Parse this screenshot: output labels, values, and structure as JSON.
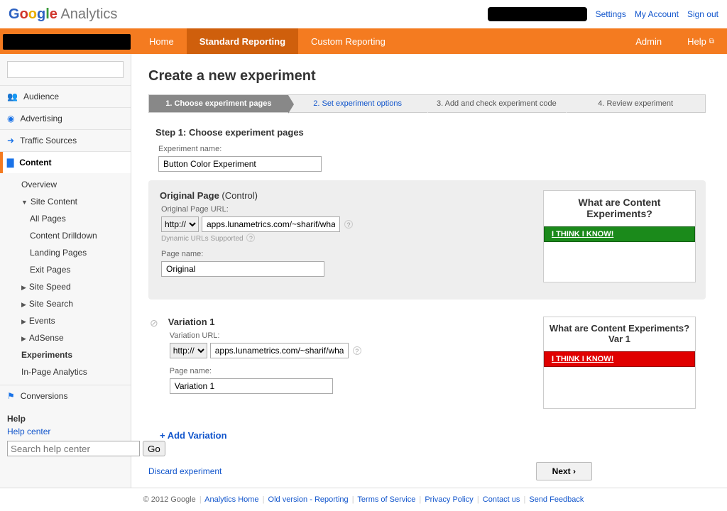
{
  "top": {
    "logo_analytics": "Analytics",
    "links": {
      "settings": "Settings",
      "account": "My Account",
      "signout": "Sign out"
    }
  },
  "nav": {
    "home": "Home",
    "standard": "Standard Reporting",
    "custom": "Custom Reporting",
    "admin": "Admin",
    "help": "Help"
  },
  "sidebar": {
    "audience": "Audience",
    "advertising": "Advertising",
    "traffic": "Traffic Sources",
    "content": "Content",
    "content_items": {
      "overview": "Overview",
      "site_content": "Site Content",
      "all_pages": "All Pages",
      "drilldown": "Content Drilldown",
      "landing": "Landing Pages",
      "exit": "Exit Pages",
      "site_speed": "Site Speed",
      "site_search": "Site Search",
      "events": "Events",
      "adsense": "AdSense",
      "experiments": "Experiments",
      "inpage": "In-Page Analytics"
    },
    "conversions": "Conversions",
    "help_title": "Help",
    "help_center": "Help center",
    "help_placeholder": "Search help center",
    "go": "Go"
  },
  "main": {
    "title": "Create a new experiment",
    "steps": {
      "s1": "1. Choose experiment pages",
      "s2": "2. Set experiment options",
      "s3": "3. Add and check experiment code",
      "s4": "4. Review experiment"
    },
    "step_head": "Step 1: Choose experiment pages",
    "exp_name_label": "Experiment name:",
    "exp_name_value": "Button Color Experiment",
    "original": {
      "title": "Original Page",
      "control": " (Control)",
      "url_label": "Original Page URL:",
      "protocol": "http://",
      "url_value": "apps.lunametrics.com/~sharif/whatthetest/i",
      "dyn": "Dynamic URLs Supported",
      "name_label": "Page name:",
      "name_value": "Original",
      "preview_title": "What are Content Experiments?",
      "preview_btn": "I THINK I KNOW!"
    },
    "var1": {
      "title": "Variation 1",
      "url_label": "Variation URL:",
      "protocol": "http://",
      "url_value": "apps.lunametrics.com/~sharif/whatthetest/v",
      "name_label": "Page name:",
      "name_value": "Variation 1",
      "preview_title": "What are Content Experiments? Var 1",
      "preview_btn": "I THINK I KNOW!"
    },
    "add_variation": "+ Add Variation",
    "discard": "Discard experiment",
    "next": "Next ›"
  },
  "footer": {
    "copyright": "© 2012 Google",
    "links": {
      "home": "Analytics Home",
      "old": "Old version - Reporting",
      "tos": "Terms of Service",
      "privacy": "Privacy Policy",
      "contact": "Contact us",
      "feedback": "Send Feedback"
    }
  }
}
